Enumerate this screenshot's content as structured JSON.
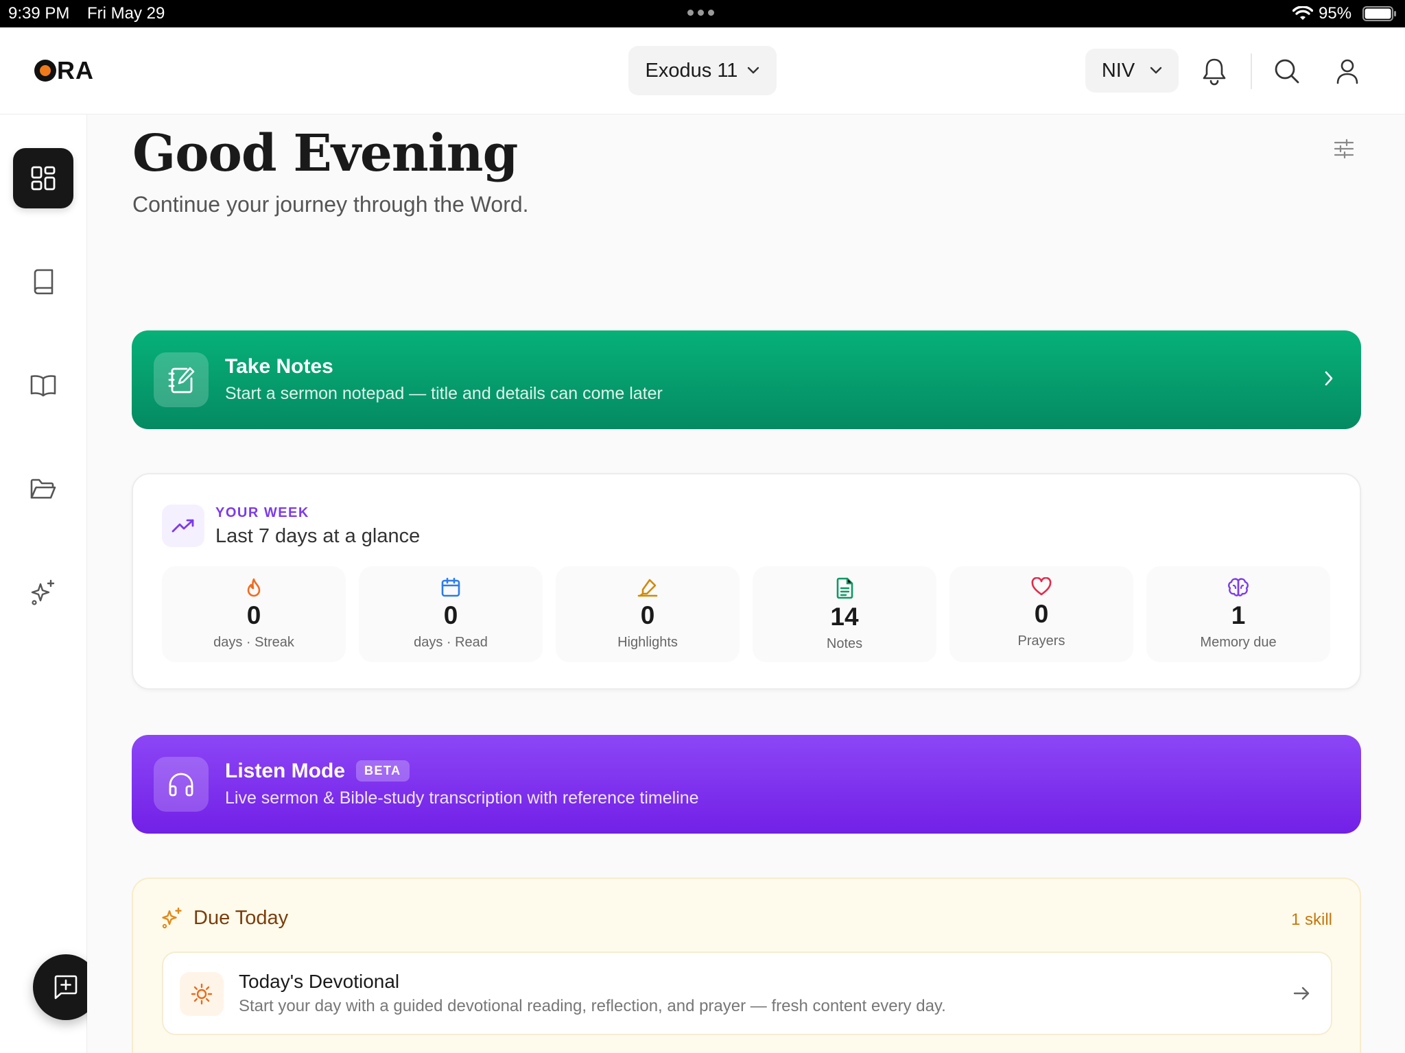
{
  "status_bar": {
    "time": "9:39 PM",
    "date": "Fri May 29",
    "battery": "95%"
  },
  "header": {
    "logo_text": "RA",
    "chapter": "Exodus 11",
    "version": "NIV"
  },
  "colors": {
    "notes_green": "#06b178",
    "listen_purple": "#7c3aed",
    "due_amber": "#c6770b",
    "streak_orange": "#f26b1d",
    "read_blue": "#2b7de9",
    "highlight_amber": "#d18a06",
    "notes_teal": "#0c9a63",
    "prayers_red": "#e5294a"
  },
  "main": {
    "greeting": "Good Evening",
    "subtitle": "Continue your journey through the Word."
  },
  "take_notes": {
    "title": "Take Notes",
    "subtitle": "Start a sermon notepad — title and details can come later"
  },
  "week": {
    "kicker": "YOUR WEEK",
    "title": "Last 7 days at a glance",
    "stats": [
      {
        "value": "0",
        "label": "days · Streak",
        "icon": "flame-icon"
      },
      {
        "value": "0",
        "label": "days · Read",
        "icon": "calendar-icon"
      },
      {
        "value": "0",
        "label": "Highlights",
        "icon": "highlighter-icon"
      },
      {
        "value": "14",
        "label": "Notes",
        "icon": "document-icon"
      },
      {
        "value": "0",
        "label": "Prayers",
        "icon": "heart-icon"
      },
      {
        "value": "1",
        "label": "Memory due",
        "icon": "brain-icon"
      }
    ]
  },
  "listen_mode": {
    "title": "Listen Mode",
    "badge": "BETA",
    "subtitle": "Live sermon & Bible-study transcription with reference timeline"
  },
  "due_today": {
    "title": "Due Today",
    "count": "1 skill",
    "task_title": "Today's Devotional",
    "task_desc": "Start your day with a guided devotional reading, reflection, and prayer — fresh content every day."
  }
}
